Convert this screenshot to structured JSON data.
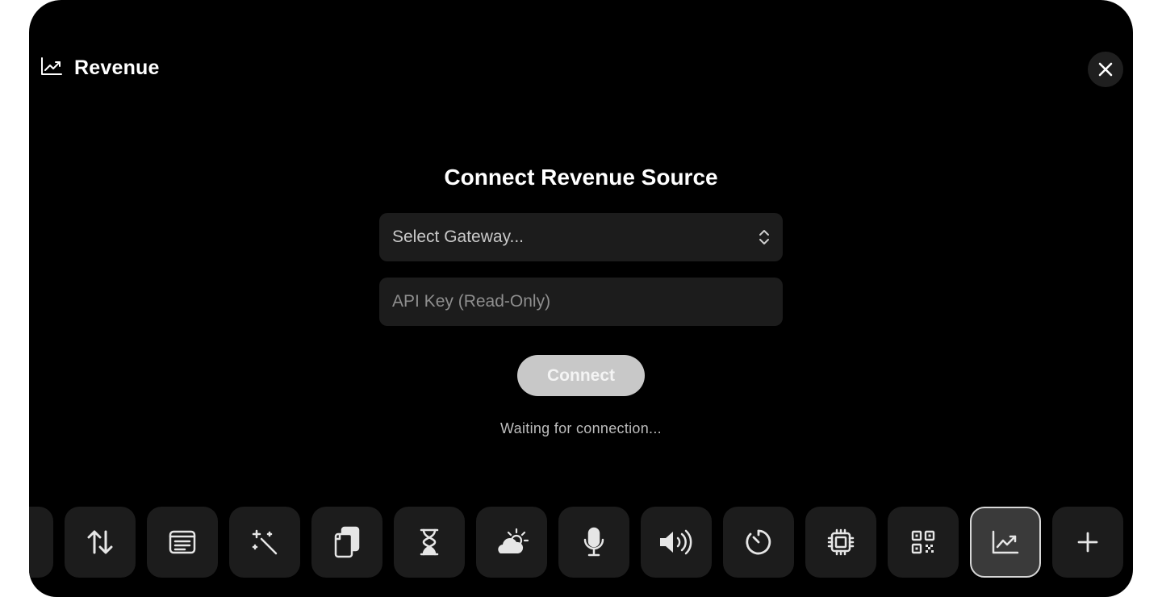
{
  "header": {
    "title": "Revenue",
    "icon": "chart-line-icon"
  },
  "form": {
    "title": "Connect Revenue Source",
    "gateway_select": {
      "value": "Select Gateway..."
    },
    "api_key_input": {
      "placeholder": "API Key (Read-Only)",
      "value": ""
    },
    "connect_label": "Connect",
    "status": "Waiting for connection..."
  },
  "dock": {
    "items": [
      {
        "icon": "partial-item-icon"
      },
      {
        "icon": "swap-vertical-icon"
      },
      {
        "icon": "notes-icon"
      },
      {
        "icon": "magic-wand-icon"
      },
      {
        "icon": "clipboard-icon"
      },
      {
        "icon": "hourglass-icon"
      },
      {
        "icon": "weather-icon"
      },
      {
        "icon": "microphone-icon"
      },
      {
        "icon": "volume-icon"
      },
      {
        "icon": "timer-icon"
      },
      {
        "icon": "cpu-icon"
      },
      {
        "icon": "qr-code-icon"
      },
      {
        "icon": "chart-line-icon",
        "active": true
      },
      {
        "icon": "plus-icon"
      }
    ]
  },
  "colors": {
    "background": "#000000",
    "surface": "#1c1c1c",
    "button": "#c8c8c8"
  }
}
